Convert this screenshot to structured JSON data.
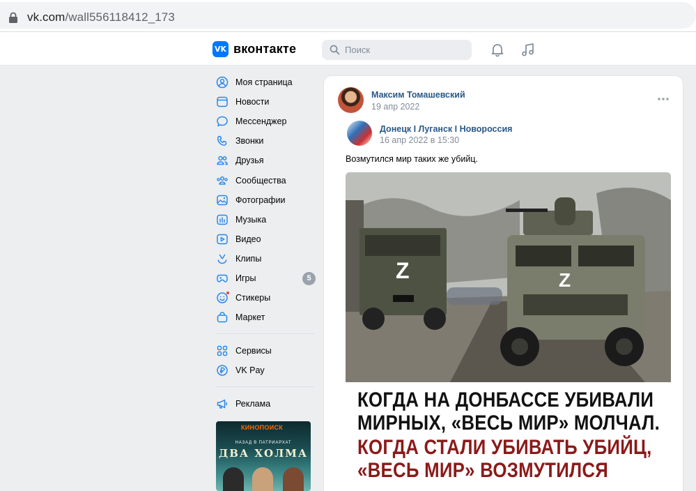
{
  "browser": {
    "url_host": "vk.com",
    "url_path": "/wall556118412_173"
  },
  "header": {
    "logo_mark": "VK",
    "logo_text": "вконтакте",
    "search_placeholder": "Поиск"
  },
  "menu": {
    "items": [
      {
        "label": "Моя страница",
        "icon": "user-circle-icon"
      },
      {
        "label": "Новости",
        "icon": "news-icon"
      },
      {
        "label": "Мессенджер",
        "icon": "message-icon"
      },
      {
        "label": "Звонки",
        "icon": "phone-icon"
      },
      {
        "label": "Друзья",
        "icon": "friends-icon"
      },
      {
        "label": "Сообщества",
        "icon": "communities-icon"
      },
      {
        "label": "Фотографии",
        "icon": "photo-icon"
      },
      {
        "label": "Музыка",
        "icon": "music-icon"
      },
      {
        "label": "Видео",
        "icon": "video-icon"
      },
      {
        "label": "Клипы",
        "icon": "clips-icon"
      },
      {
        "label": "Игры",
        "icon": "gamepad-icon",
        "badge": "5"
      },
      {
        "label": "Стикеры",
        "icon": "sticker-icon"
      },
      {
        "label": "Маркет",
        "icon": "market-bag-icon"
      }
    ],
    "services": [
      {
        "label": "Сервисы",
        "icon": "grid-icon"
      },
      {
        "label": "VK Pay",
        "icon": "vkpay-icon"
      }
    ],
    "ads": [
      {
        "label": "Реклама",
        "icon": "megaphone-icon"
      }
    ]
  },
  "ad": {
    "brand": "КИНОПОИСК",
    "subtitle": "НАЗАД В ПАТРИАРХАТ",
    "title": "ДВА ХОЛМА"
  },
  "post": {
    "author": "Максим Томашевский",
    "date": "19 апр 2022",
    "repost": {
      "source": "Донецк I Луганск I Новороссия",
      "date": "16 апр 2022 в 15:30",
      "text": "Возмутился мир таких же убийц."
    },
    "image_caption": {
      "line1": "КОГДА НА ДОНБАССЕ УБИВАЛИ",
      "line2": "МИРНЫХ, «ВЕСЬ МИР» МОЛЧАЛ.",
      "line3": "КОГДА СТАЛИ УБИВАТЬ УБИЙЦ,",
      "line4": "«ВЕСЬ МИР» ВОЗМУТИЛСЯ"
    },
    "vehicle_marking": "Z"
  },
  "colors": {
    "vk_blue": "#0077ff",
    "link": "#2a5885",
    "muted": "#818c99",
    "menu_icon": "#2688eb",
    "caption_red": "#8b1a1a"
  }
}
